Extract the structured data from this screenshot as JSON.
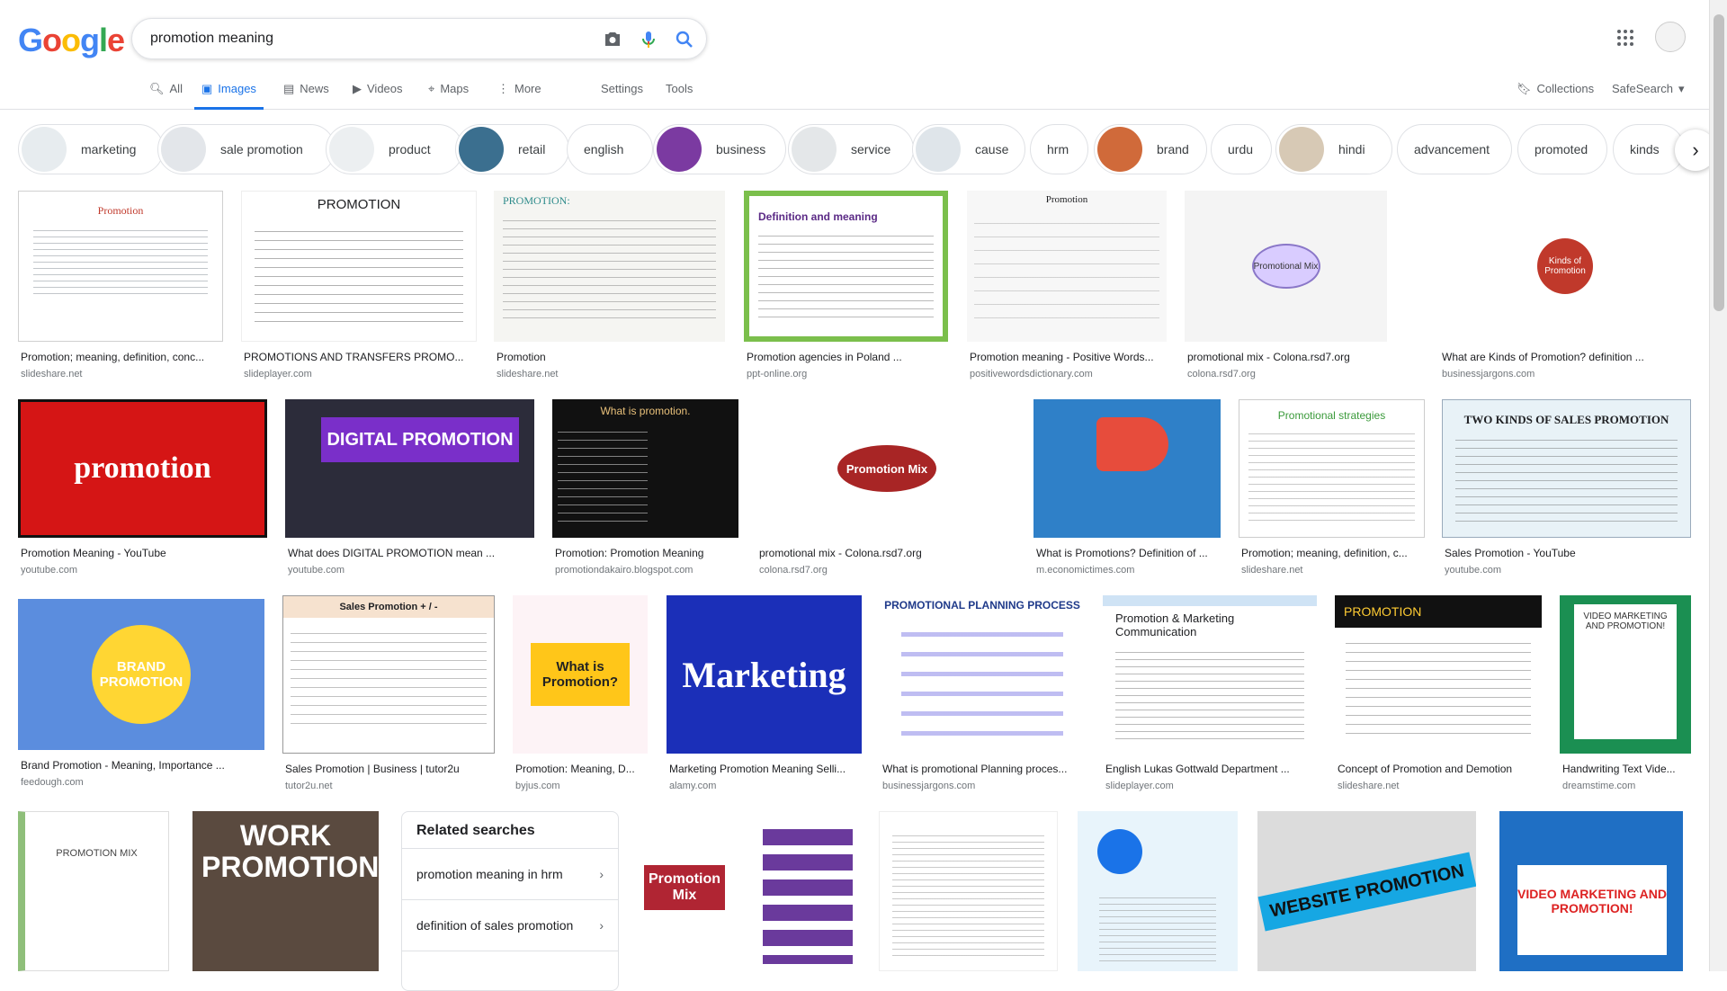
{
  "logo": [
    "G",
    "o",
    "o",
    "g",
    "l",
    "e"
  ],
  "logo_colors": [
    "#4285f4",
    "#ea4335",
    "#fbbc05",
    "#4285f4",
    "#34a853",
    "#ea4335"
  ],
  "search": {
    "query": "promotion meaning"
  },
  "nav": {
    "all": "All",
    "images": "Images",
    "news": "News",
    "videos": "Videos",
    "maps": "Maps",
    "more": "More",
    "settings": "Settings",
    "tools": "Tools",
    "collections": "Collections",
    "safesearch": "SafeSearch"
  },
  "chips": [
    "marketing",
    "sale promotion",
    "product",
    "retail",
    "english",
    "business",
    "service",
    "cause",
    "hrm",
    "brand",
    "urdu",
    "hindi",
    "advancement",
    "promoted",
    "kinds"
  ],
  "results": [
    {
      "caption": "Promotion; meaning, definition, conc...",
      "source": "slideshare.net",
      "title": "Promotion"
    },
    {
      "caption": "PROMOTIONS AND TRANSFERS PROMO...",
      "source": "slideplayer.com",
      "title": "PROMOTION"
    },
    {
      "caption": "Promotion",
      "source": "slideshare.net",
      "title": "PROMOTION:"
    },
    {
      "caption": "Promotion agencies in Poland ...",
      "source": "ppt-online.org",
      "title": "Definition and meaning"
    },
    {
      "caption": "Promotion meaning - Positive Words...",
      "source": "positivewordsdictionary.com",
      "title": "Promotion"
    },
    {
      "caption": "promotional mix - Colona.rsd7.org",
      "source": "colona.rsd7.org",
      "title": "Promotional Mix"
    },
    {
      "caption": "What are Kinds of Promotion? definition ...",
      "source": "businessjargons.com",
      "title": "Kinds of Promotion"
    },
    {
      "caption": "Promotion Meaning - YouTube",
      "source": "youtube.com",
      "title": "promotion"
    },
    {
      "caption": "What does DIGITAL PROMOTION mean ...",
      "source": "youtube.com",
      "title": "DIGITAL PROMOTION"
    },
    {
      "caption": "Promotion: Promotion Meaning",
      "source": "promotiondakairo.blogspot.com",
      "title": "What is promotion."
    },
    {
      "caption": "promotional mix - Colona.rsd7.org",
      "source": "colona.rsd7.org",
      "title": "Promotion Mix"
    },
    {
      "caption": "What is Promotions? Definition of ...",
      "source": "m.economictimes.com",
      "title": ""
    },
    {
      "caption": "Promotion; meaning, definition, c...",
      "source": "slideshare.net",
      "title": "Promotional strategies"
    },
    {
      "caption": "Sales Promotion - YouTube",
      "source": "youtube.com",
      "title": "TWO KINDS OF SALES PROMOTION"
    },
    {
      "caption": "Brand Promotion - Meaning, Importance ...",
      "source": "feedough.com",
      "title": "BRAND PROMOTION"
    },
    {
      "caption": "Sales Promotion | Business | tutor2u",
      "source": "tutor2u.net",
      "title": "Sales Promotion + / -"
    },
    {
      "caption": "Promotion: Meaning, D...",
      "source": "byjus.com",
      "title": "What is Promotion?"
    },
    {
      "caption": "Marketing Promotion Meaning Selli...",
      "source": "alamy.com",
      "title": "Marketing"
    },
    {
      "caption": "What is promotional Planning proces...",
      "source": "businessjargons.com",
      "title": "PROMOTIONAL PLANNING PROCESS"
    },
    {
      "caption": "English Lukas Gottwald Department ...",
      "source": "slideplayer.com",
      "title": "Promotion & Marketing Communication"
    },
    {
      "caption": "Concept of Promotion and Demotion",
      "source": "slideshare.net",
      "title": "PROMOTION"
    },
    {
      "caption": "Handwriting Text Vide...",
      "source": "dreamstime.com",
      "title": "VIDEO MARKETING AND PROMOTION!"
    },
    {
      "caption": "",
      "source": "",
      "title": "PROMOTION MIX"
    },
    {
      "caption": "",
      "source": "",
      "title": "WORK PROMOTION!"
    },
    {
      "caption": "",
      "source": "",
      "title": "Promotion Mix"
    },
    {
      "caption": "",
      "source": "",
      "title": ""
    },
    {
      "caption": "",
      "source": "",
      "title": ""
    },
    {
      "caption": "",
      "source": "",
      "title": "WEBSITE PROMOTION"
    },
    {
      "caption": "",
      "source": "",
      "title": "VIDEO MARKETING AND PROMOTION!"
    }
  ],
  "related": {
    "heading": "Related searches",
    "items": [
      "promotion meaning in hrm",
      "definition of sales promotion"
    ]
  }
}
